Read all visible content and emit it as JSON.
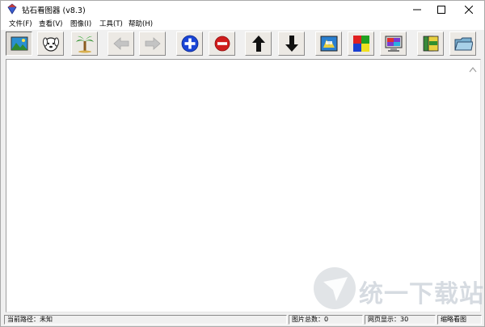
{
  "window": {
    "title": "钻石看图器 (v8.3)"
  },
  "menu": [
    {
      "label": "文件(F)"
    },
    {
      "label": "查看(V)"
    },
    {
      "label": "图像(I)"
    },
    {
      "label": "工具(T)"
    },
    {
      "label": "帮助(H)"
    }
  ],
  "toolbar": {
    "buttons": [
      {
        "icon": "landscape-picture-icon"
      },
      {
        "icon": "dog-face-icon"
      },
      {
        "icon": "palm-tree-icon"
      },
      {
        "icon": "arrow-left-icon"
      },
      {
        "icon": "arrow-right-icon"
      },
      {
        "icon": "zoom-in-plus-icon"
      },
      {
        "icon": "zoom-out-minus-icon"
      },
      {
        "icon": "arrow-up-icon"
      },
      {
        "icon": "arrow-down-icon"
      },
      {
        "icon": "image-process-icon"
      },
      {
        "icon": "color-squares-icon"
      },
      {
        "icon": "monitor-icon"
      },
      {
        "icon": "books-icon"
      },
      {
        "icon": "folder-icon"
      }
    ],
    "colors": {
      "plus": "#1a45d6",
      "minus": "#d01c1c",
      "disabled": "#b8b8b8"
    }
  },
  "statusbar": {
    "path": "当前路径：未知",
    "total": "图片总数：0",
    "per_page": "网页显示：30",
    "mode": "缩略看图"
  },
  "watermark": {
    "text": "统一下载站"
  }
}
